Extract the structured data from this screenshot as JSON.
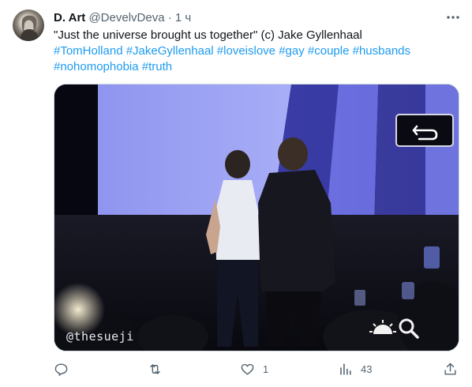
{
  "author": {
    "name": "D. Art",
    "handle": "@DevelvDeva",
    "separator": "·",
    "time": "1 ч"
  },
  "tweet": {
    "quote": "\"Just the universe brought us together\" (c) Jake Gyllenhaal",
    "hashtags_line1": [
      "#TomHolland",
      "#JakeGyllenhaal",
      "#loveislove",
      "#gay",
      "#couple",
      "#husbands"
    ],
    "hashtags_line2": [
      "#nohomophobia",
      "#truth"
    ]
  },
  "media": {
    "watermark": "@thesueji",
    "icons": [
      "back-arrow-icon",
      "sun-icon",
      "magnifier-icon"
    ]
  },
  "actions": {
    "reply_count": "",
    "retweet_count": "",
    "like_count": "1",
    "views_count": "43"
  },
  "colors": {
    "text": "#0f1419",
    "secondary": "#536471",
    "hashtag": "#1d9bf0",
    "border": "#cfd9de"
  }
}
